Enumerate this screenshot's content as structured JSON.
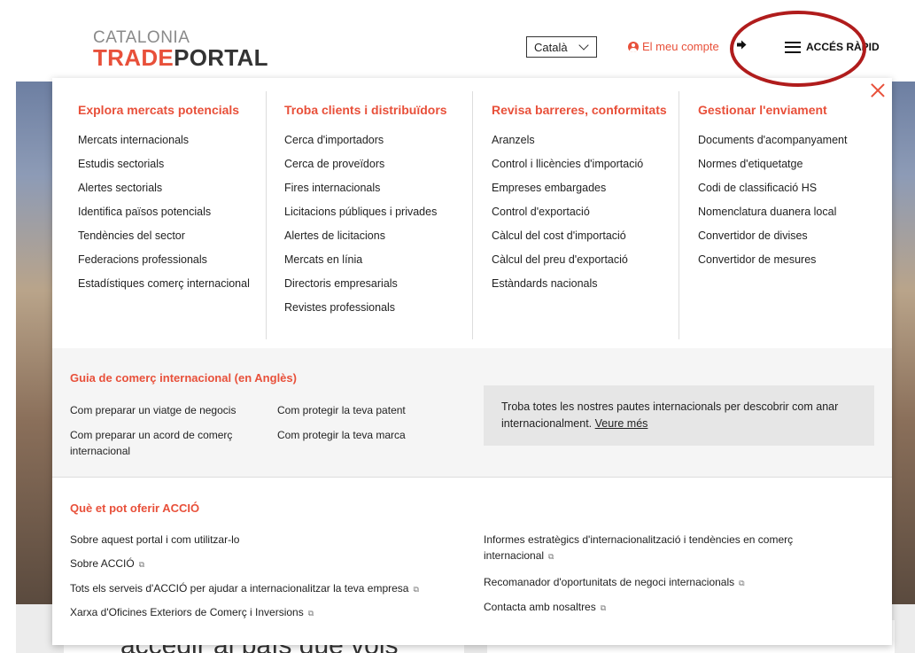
{
  "header": {
    "logo_top": "CATALONIA",
    "logo_trade": "TRADE",
    "logo_portal": "PORTAL",
    "language": "Català",
    "account_label": "El meu compte",
    "logout_icon": "logout-icon",
    "menu_label": "ACCÉS RÀPID"
  },
  "colors": {
    "accent": "#e8503a",
    "highlight_ring": "#b01c1c"
  },
  "background": {
    "card_title": "accedir al país que vols"
  },
  "columns": [
    {
      "title": "Explora mercats potencials",
      "items": [
        "Mercats internacionals",
        "Estudis sectorials",
        "Alertes sectorials",
        "Identifica països potencials",
        "Tendències del sector",
        "Federacions professionals",
        "Estadístiques comerç internacional"
      ]
    },
    {
      "title": "Troba clients i distribuïdors",
      "items": [
        "Cerca d'importadors",
        "Cerca de proveïdors",
        "Fires internacionals",
        "Licitacions públiques i privades",
        "Alertes de licitacions",
        "Mercats en línia",
        "Directoris empresarials",
        "Revistes professionals"
      ]
    },
    {
      "title": "Revisa barreres, conformitats",
      "items": [
        "Aranzels",
        "Control i llicències d'importació",
        "Empreses embargades",
        "Control d'exportació",
        "Càlcul del cost d'importació",
        "Càlcul del preu d'exportació",
        "Estàndards nacionals"
      ]
    },
    {
      "title": "Gestionar l'enviament",
      "items": [
        "Documents d'acompanyament",
        "Normes d'etiquetatge",
        "Codi de classificació HS",
        "Nomenclatura duanera local",
        "Convertidor de divises",
        "Convertidor de mesures"
      ]
    }
  ],
  "guide": {
    "title": "Guia de comerç internacional (en Anglès)",
    "links": [
      "Com preparar un viatge de negocis",
      "Com protegir la teva patent",
      "Com preparar un acord de comerç internacional",
      "Com protegir la teva marca"
    ],
    "info_text": "Troba totes les nostres pautes internacionals per descobrir com anar internacionalment.",
    "info_link": "Veure més"
  },
  "accio": {
    "title": "Què et pot oferir ACCIÓ",
    "left_links": [
      "Sobre aquest portal i com utilitzar-lo",
      "Sobre ACCIÓ",
      "Tots els serveis d'ACCIÓ per ajudar a internacionalitzar la teva empresa",
      "Xarxa d'Oficines Exteriors de Comerç i Inversions"
    ],
    "right_links": [
      "Informes estratègics d'internacionalització i tendències en comerç internacional",
      "Recomanador d'oportunitats de negoci internacionals",
      "Contacta amb nosaltres"
    ],
    "external_glyph": "⧉"
  }
}
